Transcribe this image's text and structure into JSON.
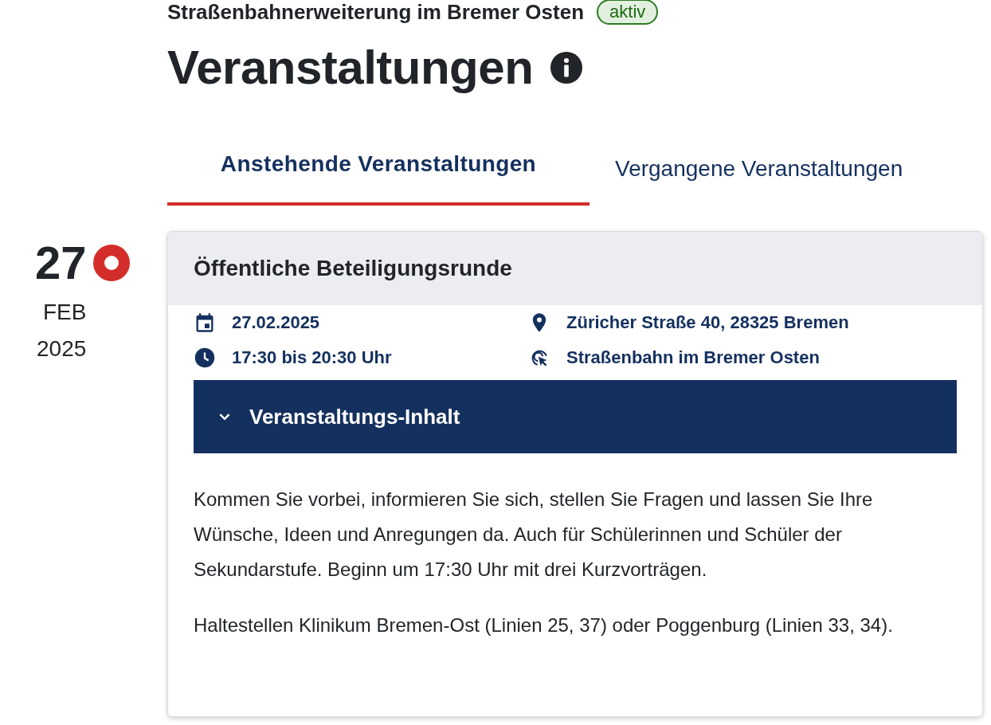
{
  "project": {
    "title": "Straßenbahnerweiterung im Bremer Osten",
    "status": "aktiv"
  },
  "page_title": "Veranstaltungen",
  "tabs": [
    {
      "label": "Anstehende Veranstaltungen",
      "selected": true
    },
    {
      "label": "Vergangene Veranstaltungen",
      "selected": false
    }
  ],
  "events": [
    {
      "day": "27",
      "month": "FEB",
      "year": "2025",
      "live": true,
      "title": "Öffentliche Beteiligungsrunde",
      "details": [
        {
          "kind": "date",
          "text": "27.02.2025"
        },
        {
          "kind": "location",
          "text": "Züricher Straße 40, 28325 Bremen"
        },
        {
          "kind": "time",
          "text": "17:30 bis 20:30 Uhr"
        },
        {
          "kind": "project",
          "text": "Straßenbahn im Bremer Osten"
        }
      ],
      "content": {
        "label": "Veranstaltungs-Inhalt",
        "expanded": true,
        "paragraphs": [
          "Kommen Sie vorbei, informieren Sie sich, stellen Sie Fragen und lassen Sie Ihre Wünsche, Ideen und Anregungen da. Auch für Schülerinnen und Schüler der Sekundarstufe. Beginn um 17:30 Uhr mit drei Kurzvorträgen.",
          "Haltestellen Klinikum Bremen-Ost (Linien 25, 37) oder Poggenburg (Linien 33, 34)."
        ]
      }
    }
  ]
}
